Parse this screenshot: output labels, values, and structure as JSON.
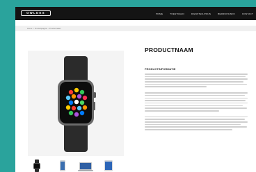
{
  "header": {
    "logo_text": "OWLDES",
    "nav": [
      "HOME",
      "TOESTRAAN",
      "DIENSTEN-PRIJS",
      "BEDRIJFSINFO",
      "CONTACT"
    ]
  },
  "breadcrumb": [
    "Home",
    "/ Productpagina",
    "/ Productnaam"
  ],
  "product": {
    "title": "PRODUCTNAAM",
    "info_heading": "PRODUCTINFORMATIE"
  },
  "thumbnails": [
    "watch-thumbnail",
    "iphone-thumbnail",
    "macbook-thumbnail",
    "ipad-thumbnail"
  ],
  "colors": {
    "background": "#2aa39c",
    "header": "#141414",
    "breadcrumb_bar": "#f0f0f0"
  }
}
